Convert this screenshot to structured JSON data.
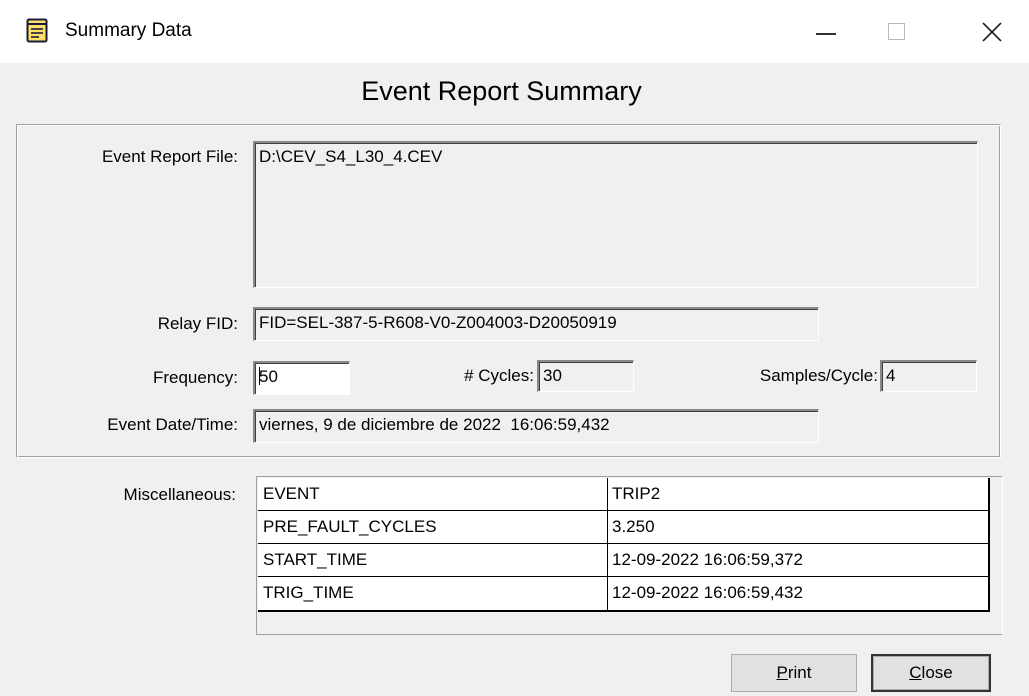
{
  "window": {
    "title": "Summary Data",
    "icon": "notepad-icon",
    "controls": [
      "minimize",
      "maximize",
      "close"
    ]
  },
  "heading": "Event Report Summary",
  "fields": {
    "event_report_file": {
      "label": "Event Report File:",
      "value": "D:\\CEV_S4_L30_4.CEV"
    },
    "relay_fid": {
      "label": "Relay FID:",
      "value": "FID=SEL-387-5-R608-V0-Z004003-D20050919"
    },
    "frequency": {
      "label": "Frequency:",
      "value": "50"
    },
    "cycles": {
      "label": "# Cycles:",
      "value": "30"
    },
    "samples_per_cycle": {
      "label": "Samples/Cycle:",
      "value": "4"
    },
    "event_datetime": {
      "label": "Event Date/Time:",
      "value": "viernes, 9 de diciembre de 2022  16:06:59,432"
    }
  },
  "misc": {
    "label": "Miscellaneous:",
    "rows": [
      {
        "key": "EVENT",
        "value": "TRIP2"
      },
      {
        "key": "PRE_FAULT_CYCLES",
        "value": "3.250"
      },
      {
        "key": "START_TIME",
        "value": "12-09-2022 16:06:59,372"
      },
      {
        "key": "TRIG_TIME",
        "value": "12-09-2022 16:06:59,432"
      }
    ]
  },
  "buttons": {
    "print": {
      "mnemonic": "P",
      "rest": "rint"
    },
    "close": {
      "mnemonic": "C",
      "rest": "lose"
    }
  }
}
